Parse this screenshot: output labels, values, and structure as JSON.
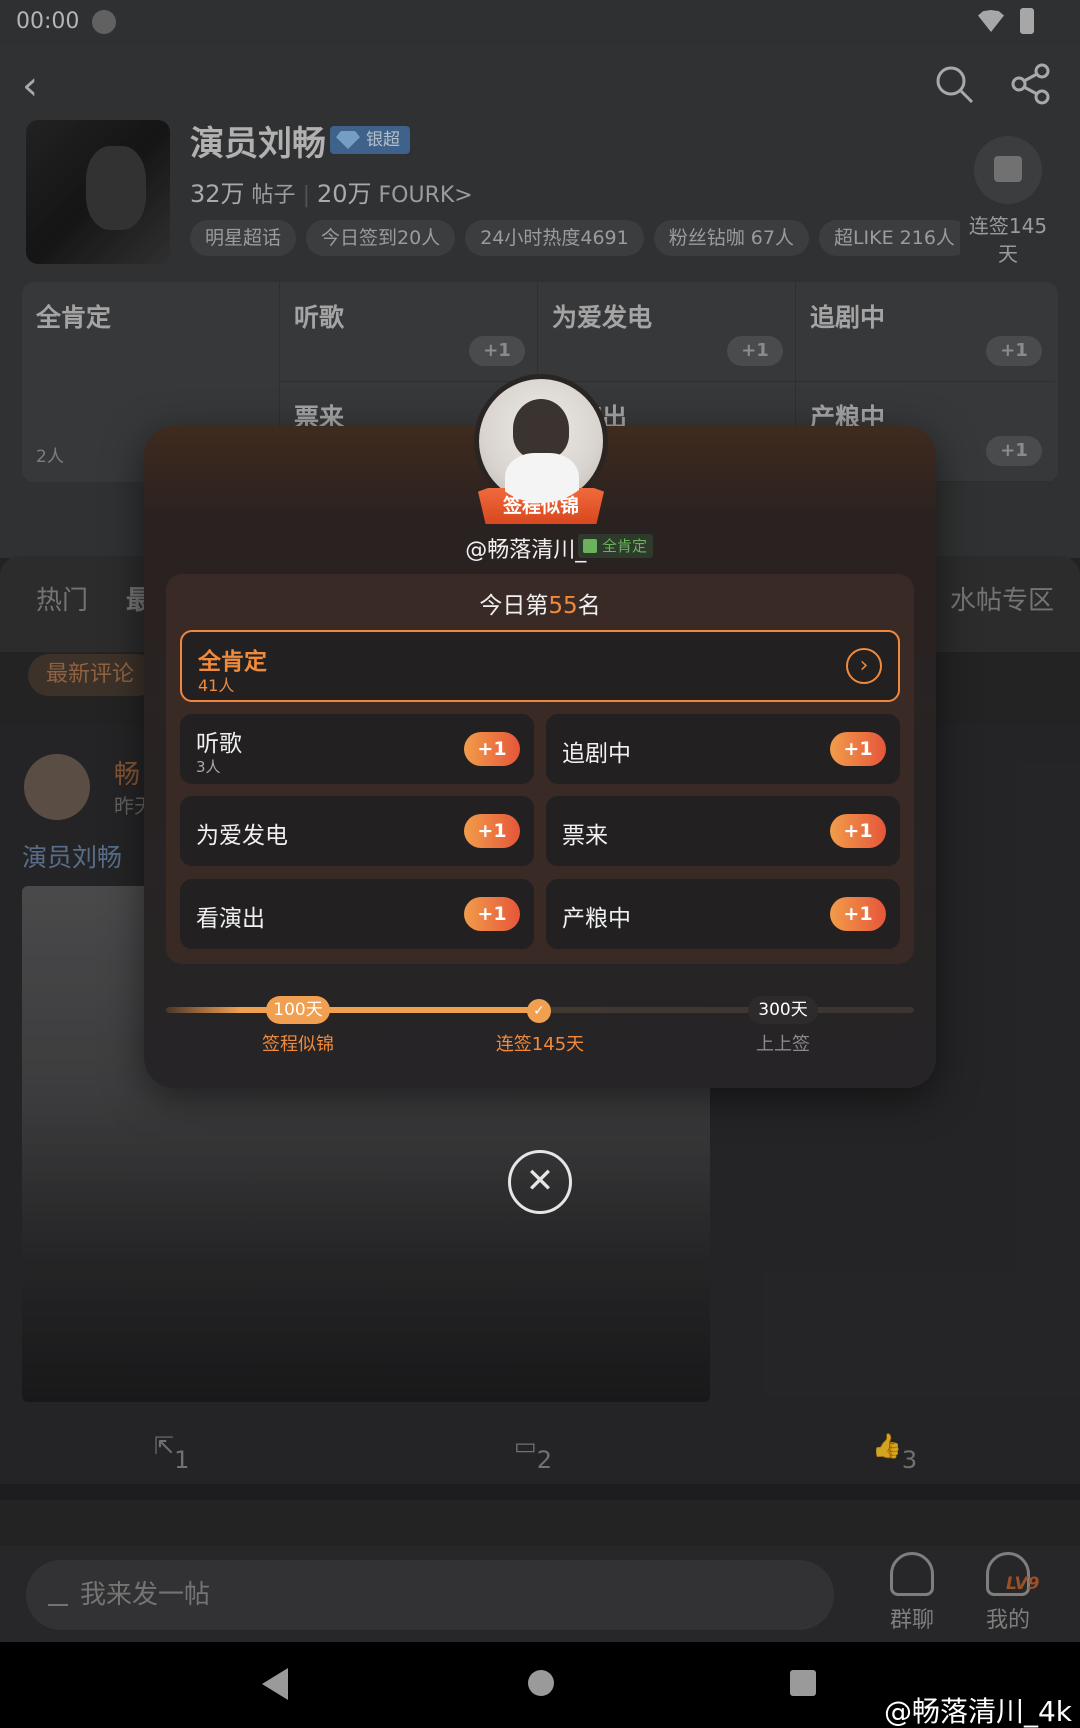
{
  "status_bar": {
    "time": "00:00"
  },
  "header": {
    "title": "演员刘畅",
    "rank_badge": "银超",
    "posts_count": "32万",
    "posts_label": "帖子",
    "fans_count": "20万",
    "fans_label": "FOURK>",
    "chips": [
      "明星超话",
      "今日签到20人",
      "24小时热度4691",
      "粉丝钻咖 67人",
      "超LIKE 216人"
    ],
    "checkin_label": "连签145天"
  },
  "bg_grid": {
    "main": {
      "label": "全肯定",
      "count": "2人"
    },
    "items": [
      {
        "label": "听歌",
        "plus": "+1"
      },
      {
        "label": "为爱发电",
        "plus": "+1"
      },
      {
        "label": "追剧中",
        "plus": "+1"
      },
      {
        "label": "票来",
        "plus": ""
      },
      {
        "label": "看演出",
        "plus": ""
      },
      {
        "label": "产粮中",
        "plus": "+1"
      }
    ]
  },
  "tabs": [
    "热门",
    "最",
    "水帖专区"
  ],
  "sort_label": "最新评论",
  "post": {
    "author": "畅",
    "time": "昨天",
    "topic": "演员刘畅"
  },
  "post_actions": {
    "repost": "1",
    "comment": "2",
    "like": "3"
  },
  "compose_placeholder": "我来发一帖",
  "bottom_nav": {
    "group": "群聊",
    "mine": "我的",
    "level": "LV9"
  },
  "watermark": "@畅落清川_4k",
  "modal": {
    "ribbon": "签程似锦",
    "username": "@畅落清川_4K",
    "tag": "全肯定",
    "rank_prefix": "今日第",
    "rank_number": "55",
    "rank_suffix": "名",
    "main_item": {
      "label": "全肯定",
      "count": "41人"
    },
    "items": [
      {
        "label": "听歌",
        "count": "3人",
        "plus": "+1"
      },
      {
        "label": "追剧中",
        "count": "",
        "plus": "+1"
      },
      {
        "label": "为爱发电",
        "count": "",
        "plus": "+1"
      },
      {
        "label": "票来",
        "count": "",
        "plus": "+1"
      },
      {
        "label": "看演出",
        "count": "",
        "plus": "+1"
      },
      {
        "label": "产粮中",
        "count": "",
        "plus": "+1"
      }
    ],
    "progress": {
      "fraction": 0.5,
      "milestone1": "100天",
      "milestone1_label": "签程似锦",
      "current_label": "连签145天",
      "milestone2": "300天",
      "milestone2_label": "上上签"
    },
    "close_icon": "close-icon"
  },
  "colors": {
    "accent": "#f08a3c",
    "plus_gradient_start": "#f29c4a",
    "plus_gradient_end": "#e5563a"
  }
}
